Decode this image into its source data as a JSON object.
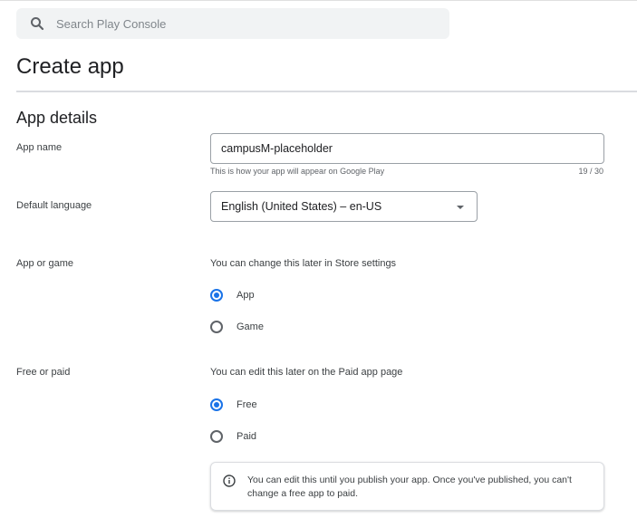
{
  "search": {
    "placeholder": "Search Play Console"
  },
  "page": {
    "title": "Create app"
  },
  "section": {
    "title": "App details"
  },
  "app_name": {
    "label": "App name",
    "value": "campusM-placeholder",
    "helper": "This is how your app will appear on Google Play",
    "counter": "19 / 30"
  },
  "default_language": {
    "label": "Default language",
    "value": "English (United States) – en-US"
  },
  "app_or_game": {
    "label": "App or game",
    "description": "You can change this later in Store settings",
    "options": [
      {
        "label": "App",
        "selected": true
      },
      {
        "label": "Game",
        "selected": false
      }
    ]
  },
  "free_or_paid": {
    "label": "Free or paid",
    "description": "You can edit this later on the Paid app page",
    "options": [
      {
        "label": "Free",
        "selected": true
      },
      {
        "label": "Paid",
        "selected": false
      }
    ],
    "info": "You can edit this until you publish your app. Once you've published, you can't change a free app to paid."
  },
  "colors": {
    "accent": "#1a73e8",
    "text": "#202124",
    "secondary": "#5f6368"
  },
  "icons": {
    "search": "search-icon",
    "dropdown": "dropdown-arrow-icon",
    "info": "info-icon"
  }
}
